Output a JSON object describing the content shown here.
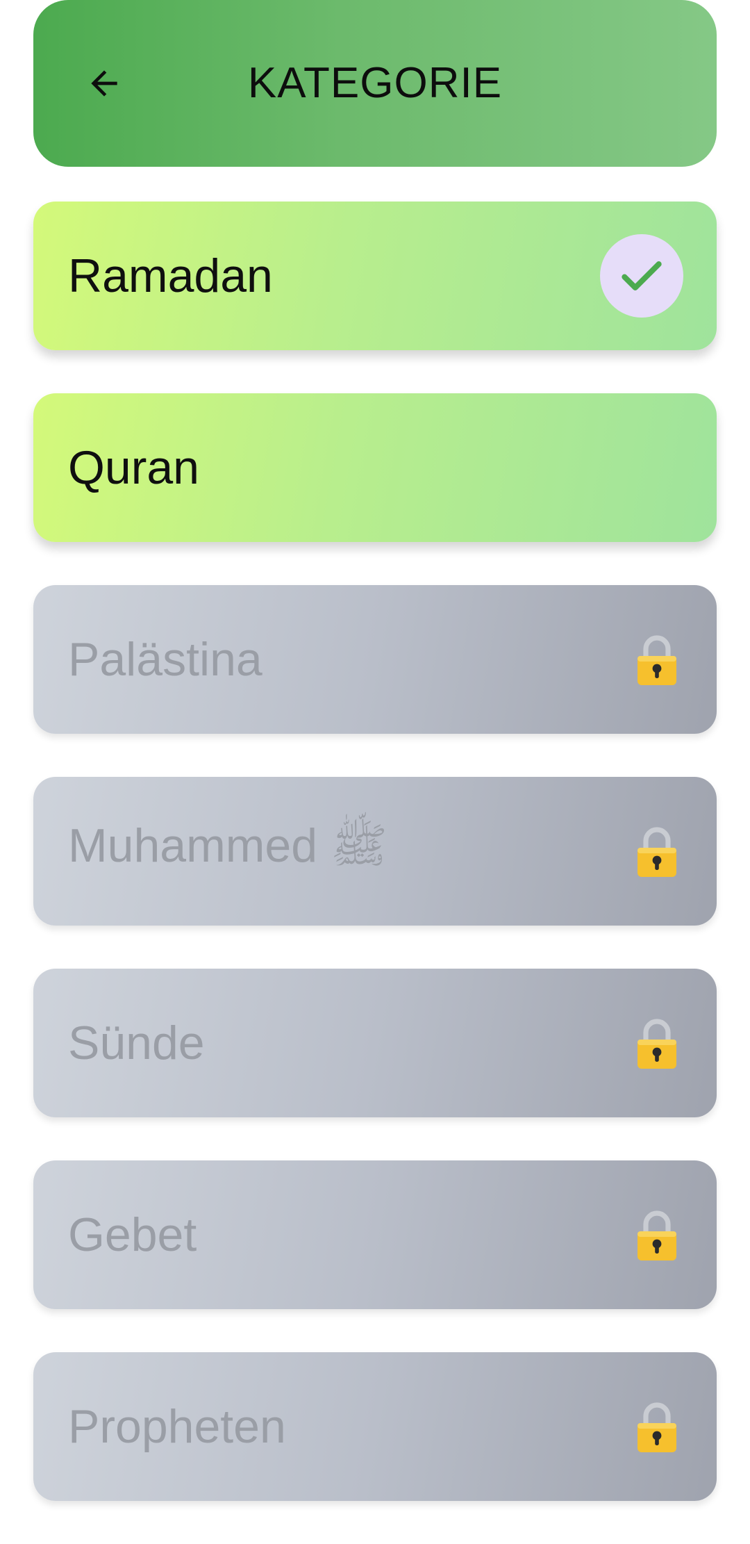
{
  "header": {
    "title": "KATEGORIE",
    "back_icon": "arrow-left-icon"
  },
  "colors": {
    "header_gradient_start": "#4caa4f",
    "header_gradient_end": "#85c886",
    "unlocked_gradient_start": "#d4f97a",
    "unlocked_gradient_end": "#9fe39c",
    "locked_gradient_start": "#ced3db",
    "locked_gradient_end": "#9fa3ae",
    "check_badge_bg": "#e6ddf9",
    "check_color": "#4caa4f",
    "lock_color": "#f6c02d"
  },
  "categories": [
    {
      "label": "Ramadan",
      "locked": false,
      "selected": true,
      "icon": "check-icon"
    },
    {
      "label": "Quran",
      "locked": false,
      "selected": false
    },
    {
      "label": "Palästina",
      "locked": true,
      "icon": "lock-icon"
    },
    {
      "label": "Muhammed ﷺ",
      "locked": true,
      "icon": "lock-icon"
    },
    {
      "label": "Sünde",
      "locked": true,
      "icon": "lock-icon"
    },
    {
      "label": "Gebet",
      "locked": true,
      "icon": "lock-icon"
    },
    {
      "label": "Propheten",
      "locked": true,
      "icon": "lock-icon"
    }
  ]
}
